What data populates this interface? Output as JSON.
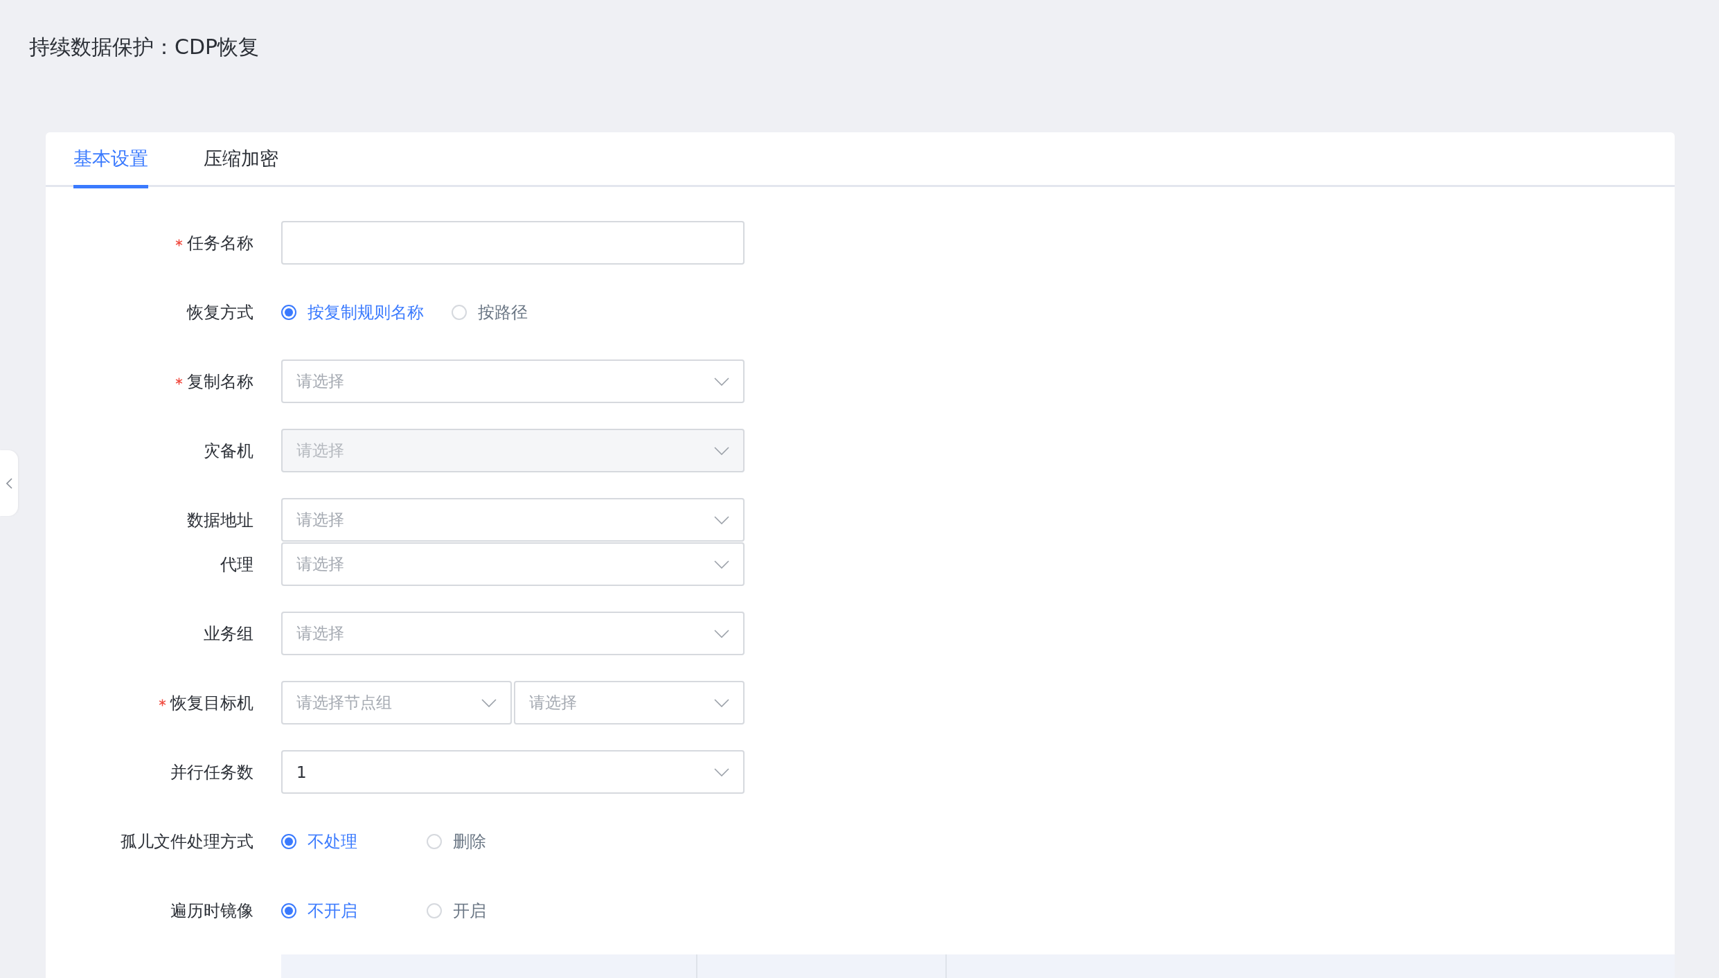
{
  "page_title": "持续数据保护：CDP恢复",
  "tabs": [
    {
      "label": "基本设置",
      "selected": true
    },
    {
      "label": "压缩加密",
      "selected": false
    }
  ],
  "form": [
    {
      "kind": "input",
      "label": "任务名称",
      "required": true
    },
    {
      "kind": "radio",
      "label": "恢复方式",
      "options": [
        {
          "label": "按复制规则名称",
          "selected": true
        },
        {
          "label": "按路径",
          "selected": false
        }
      ]
    },
    {
      "kind": "select",
      "label": "复制名称",
      "required": true,
      "placeholder": "请选择"
    },
    {
      "kind": "select",
      "label": "灾备机",
      "placeholder": "请选择",
      "disabled": true
    },
    {
      "kind": "select",
      "label": "数据地址",
      "placeholder": "请选择"
    },
    {
      "kind": "select",
      "label": "代理",
      "placeholder": "请选择",
      "attached": true
    },
    {
      "kind": "select",
      "label": "业务组",
      "placeholder": "请选择"
    },
    {
      "kind": "select_pair",
      "label": "恢复目标机",
      "required": true,
      "selects": [
        {
          "placeholder": "请选择节点组"
        },
        {
          "placeholder": "请选择"
        }
      ]
    },
    {
      "kind": "select",
      "label": "并行任务数",
      "value": "1"
    },
    {
      "kind": "radio",
      "label": "孤儿文件处理方式",
      "options": [
        {
          "label": "不处理",
          "selected": true
        },
        {
          "label": "删除",
          "selected": false
        }
      ]
    },
    {
      "kind": "radio",
      "label": "遍历时镜像",
      "options": [
        {
          "label": "不开启",
          "selected": true
        },
        {
          "label": "开启",
          "selected": false
        }
      ]
    },
    {
      "kind": "table"
    }
  ]
}
